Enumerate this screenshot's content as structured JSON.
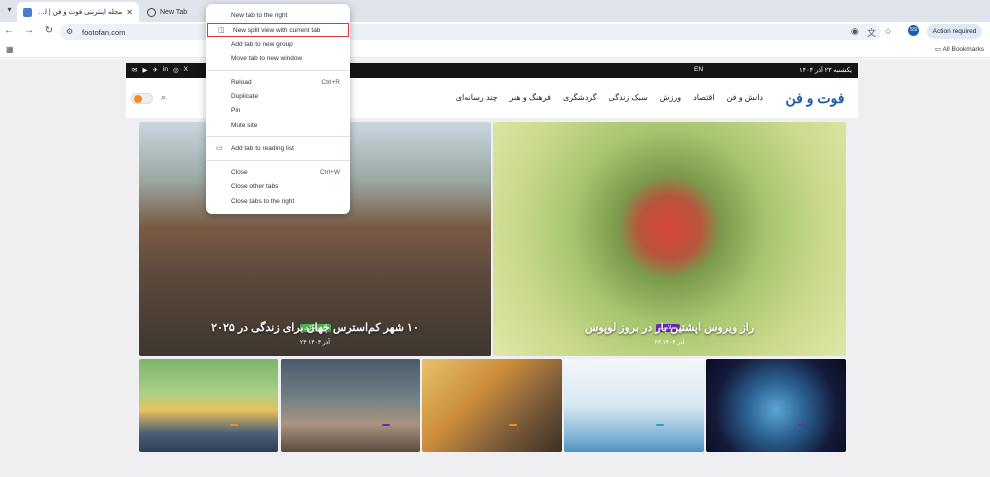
{
  "browser": {
    "tabs": [
      {
        "title": "مجله اینترنتی فوت و فن | لذت‌ها...",
        "active": true
      },
      {
        "title": "New Tab",
        "active": false
      }
    ],
    "url": "footofan.com",
    "action_required": "Action required",
    "all_bookmarks": "All Bookmarks",
    "profile_initials": "SSI"
  },
  "context_menu": {
    "items": [
      {
        "label": "New tab to the right",
        "shortcut": ""
      },
      {
        "label": "New split view with current tab",
        "shortcut": "",
        "highlighted": true
      },
      {
        "label": "Add tab to new group",
        "shortcut": ""
      },
      {
        "label": "Move tab to new window",
        "shortcut": ""
      },
      {
        "label": "Reload",
        "shortcut": "Ctrl+R"
      },
      {
        "label": "Duplicate",
        "shortcut": ""
      },
      {
        "label": "Pin",
        "shortcut": ""
      },
      {
        "label": "Mute site",
        "shortcut": ""
      },
      {
        "label": "Add tab to reading list",
        "shortcut": ""
      },
      {
        "label": "Close",
        "shortcut": "Ctrl+W"
      },
      {
        "label": "Close other tabs",
        "shortcut": ""
      },
      {
        "label": "Close tabs to the right",
        "shortcut": ""
      }
    ]
  },
  "site": {
    "topbar": {
      "date": "یکشنبه ۲۳ آذر ۱۴۰۴",
      "lang": "EN",
      "links": [
        "",
        "",
        ""
      ]
    },
    "logo": "فوت و فن",
    "menu": [
      "دانش و فن",
      "اقتصاد",
      "ورزش",
      "سبک زندگی",
      "گردشگری",
      "فرهنگ و هنر",
      "چند رسانه‌ای"
    ],
    "featured": [
      {
        "category": "سلامت",
        "title": "راز ویروس اپشتین بار در بروز لوپوس",
        "date": "۲۳ آذر ۱۴۰۴",
        "cat_color": "purple"
      },
      {
        "category": "گردشگری",
        "title": "۱۰ شهر کم‌استرس جهان برای زندگی در ۲۰۲۵",
        "date": "۲۳ آذر ۱۴۰۴",
        "cat_color": "green"
      }
    ],
    "cards": [
      {
        "category": "",
        "title": "",
        "cat_color": "purple"
      },
      {
        "category": "",
        "title": "",
        "cat_color": "blue"
      },
      {
        "category": "",
        "title": "",
        "cat_color": "orange"
      },
      {
        "category": "",
        "title": "",
        "cat_color": "purple"
      },
      {
        "category": "",
        "title": "",
        "cat_color": "orange"
      }
    ]
  }
}
